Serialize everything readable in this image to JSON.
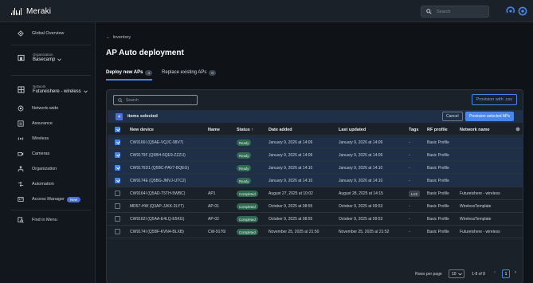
{
  "app": {
    "name": "Meraki"
  },
  "topbar": {
    "search_placeholder": "Search"
  },
  "sidebar": {
    "global_overview": "Global Overview",
    "organization_label": "Organization",
    "organization_value": "Basecamp",
    "network_label": "Network",
    "network_value": "Futureishere - wireless",
    "items": [
      {
        "label": "Network-wide"
      },
      {
        "label": "Assurance"
      },
      {
        "label": "Wireless"
      },
      {
        "label": "Cameras"
      },
      {
        "label": "Organization"
      },
      {
        "label": "Automation"
      },
      {
        "label": "Access Manager"
      }
    ],
    "new_badge": "New",
    "find_in_menu": "Find in Menu"
  },
  "breadcrumb": {
    "back_label": "Inventory"
  },
  "page": {
    "title": "AP Auto deployment"
  },
  "tabs": [
    {
      "label": "Deploy new APs",
      "count": "4"
    },
    {
      "label": "Replace existing APs",
      "count": "0"
    }
  ],
  "card": {
    "search_placeholder": "Search",
    "provision_csv_label": "Provision with .csv",
    "selection": {
      "count": "4",
      "label": "items selected",
      "cancel_label": "Cancel",
      "provision_label": "Provision selected APs"
    }
  },
  "table": {
    "headers": {
      "device": "New device",
      "name": "Name",
      "status": "Status",
      "date_added": "Date added",
      "last_updated": "Last updated",
      "tags": "Tags",
      "rf_profile": "RF profile",
      "network_name": "Network name"
    },
    "rows": [
      {
        "selected": true,
        "device": "CW9166I (Q5AE-VQJC-98V7)",
        "name": "",
        "status": "Ready",
        "date_added": "January 9, 2026 at 14:09",
        "last_updated": "January 9, 2026 at 14:09",
        "tags": "-",
        "rf_profile": "Basic Profile",
        "network": ""
      },
      {
        "selected": true,
        "device": "CW9179F (Q5BH-6QE9-ZZZU)",
        "name": "",
        "status": "Ready",
        "date_added": "January 9, 2026 at 14:09",
        "last_updated": "January 9, 2026 at 14:09",
        "tags": "-",
        "rf_profile": "Basic Profile",
        "network": ""
      },
      {
        "selected": true,
        "device": "CW9176D1 (Q5BC-PAV7-BQEG)",
        "name": "",
        "status": "Ready",
        "date_added": "January 9, 2026 at 14:10",
        "last_updated": "January 9, 2026 at 14:10",
        "tags": "-",
        "rf_profile": "Basic Profile",
        "network": ""
      },
      {
        "selected": true,
        "device": "CW9174E (Q5BG-JMVJ-UTC2)",
        "name": "",
        "status": "Ready",
        "date_added": "January 9, 2026 at 14:10",
        "last_updated": "January 9, 2026 at 14:10",
        "tags": "-",
        "rf_profile": "Basic Profile",
        "network": ""
      },
      {
        "selected": false,
        "device": "CW9164I (Q5AD-T5TH-5WBC)",
        "name": "AP1",
        "status": "Completed",
        "date_added": "August 27, 2025 at 10:02",
        "last_updated": "August 28, 2025 at 14:15",
        "tags": "LAX",
        "rf_profile": "Basic Profile",
        "network": "Futureishere - wireless"
      },
      {
        "selected": false,
        "device": "MR57-HW (Q3AP-JJKK-2LYT)",
        "name": "AP-01",
        "status": "Completed",
        "date_added": "October 9, 2025 at 08:55",
        "last_updated": "October 9, 2025 at 09:53",
        "tags": "-",
        "rf_profile": "Basic Profile",
        "network": "WirelessTemplate"
      },
      {
        "selected": false,
        "device": "CW9162I (Q5AA-E4LQ-E5KG)",
        "name": "AP-02",
        "status": "Completed",
        "date_added": "October 9, 2025 at 08:55",
        "last_updated": "October 9, 2025 at 09:53",
        "tags": "-",
        "rf_profile": "Basic Profile",
        "network": "WirelessTemplate"
      },
      {
        "selected": false,
        "device": "CW9174I (Q5BF-KVN4-BLXB)",
        "name": "CW-9176I",
        "status": "Completed",
        "date_added": "November 25, 2025 at 21:50",
        "last_updated": "November 25, 2025 at 21:52",
        "tags": "-",
        "rf_profile": "Basic Profile",
        "network": "Futureishere - wireless"
      }
    ]
  },
  "pagination": {
    "rows_per_page_label": "Rows per page",
    "rows_per_page": "10",
    "range": "1-8 of 8",
    "current_page": "1"
  },
  "colors": {
    "accent": "#4a86e8",
    "selected_row": "#1e2f47",
    "status_green": "#2f6b4f"
  }
}
